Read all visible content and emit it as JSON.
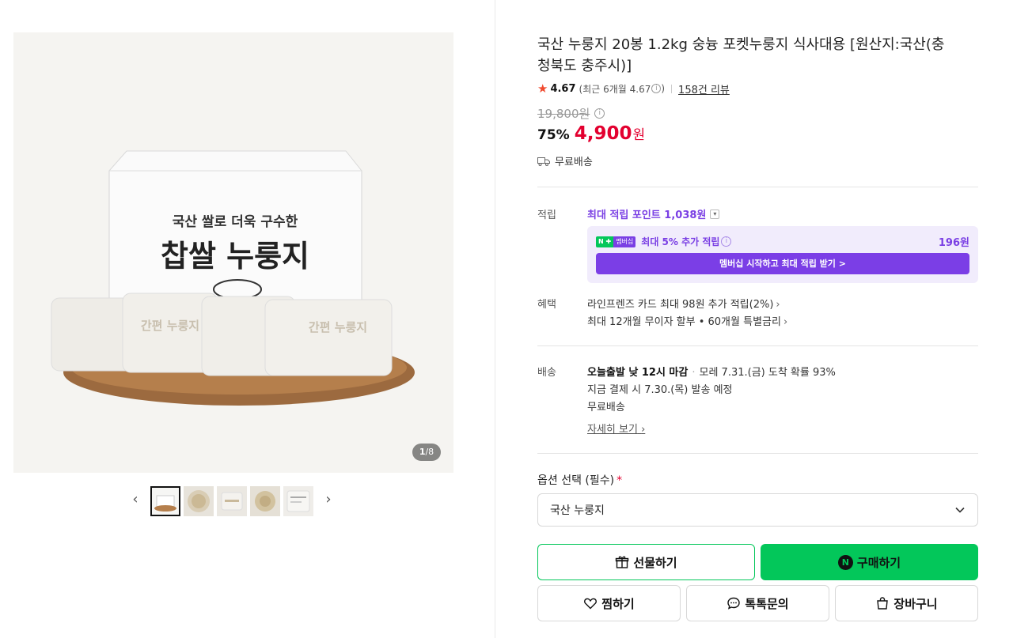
{
  "gallery": {
    "counter_current": "1",
    "counter_total": "/8",
    "prev_label": "‹",
    "next_label": "›",
    "box_text_top": "국산 쌀로 더욱 구수한",
    "box_text_main": "찹쌀 누룽지",
    "pack_text": "간편 누룽지"
  },
  "product": {
    "title": "국산 누룽지 20봉 1.2kg 숭늉 포켓누룽지 식사대용 [원산지:국산(충청북도 충주시)]",
    "rating": "4.67",
    "rating_recent": "(최근 6개월 4.67",
    "rating_recent_close": ")",
    "review_count": "158건 리뷰",
    "original_price": "19,800원",
    "discount": "75%",
    "price": "4,900",
    "currency": "원",
    "free_shipping": "무료배송"
  },
  "points": {
    "label": "적립",
    "max_points": "최대 적립 포인트 1,038원",
    "member_badge_n": "N ✚",
    "member_badge_text": "멤버십",
    "member_text": "최대 5% 추가 적립",
    "member_amount": "196원",
    "member_button": "멤버십 시작하고 최대 적립 받기 >"
  },
  "benefits": {
    "label": "혜택",
    "items": [
      "라인프렌즈 카드 최대 98원 추가 적립(2%)",
      "최대 12개월 무이자 할부 • 60개월 특별금리"
    ]
  },
  "delivery": {
    "label": "배송",
    "line1_bold": "오늘출발 낮 12시 마감",
    "line1_rest": "모레 7.31.(금) 도착 확률 93%",
    "line2": "지금 결제 시 7.30.(목) 발송 예정",
    "line3": "무료배송",
    "detail_link": "자세히 보기"
  },
  "options": {
    "label": "옵션 선택 (필수)",
    "required_mark": "*",
    "selected": "국산 누룽지"
  },
  "actions": {
    "gift": "선물하기",
    "buy": "구매하기",
    "wish": "찜하기",
    "talk": "톡톡문의",
    "cart": "장바구니"
  },
  "colors": {
    "naver_green": "#03c75a",
    "price_red": "#e3002f",
    "membership_purple": "#7b3ee6"
  }
}
